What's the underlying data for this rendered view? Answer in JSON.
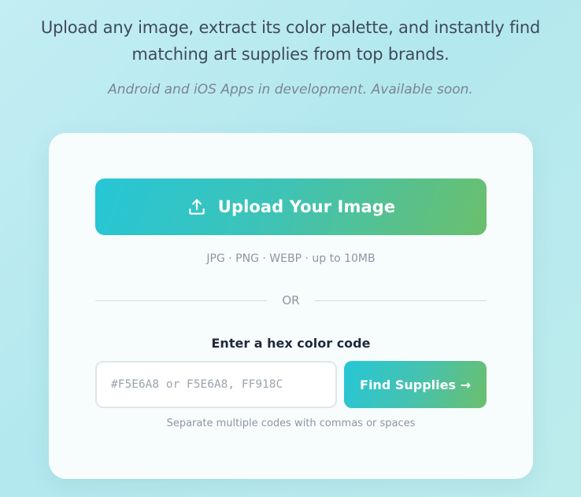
{
  "intro": {
    "line1": "Upload any image, extract its color palette, and instantly find",
    "line2": "matching art supplies from top brands."
  },
  "availability_note": "Android and iOS Apps in development. Available soon.",
  "upload": {
    "icon": "upload-icon",
    "label": "Upload Your Image",
    "formats": "JPG · PNG · WEBP · up to 10MB"
  },
  "divider_text": "OR",
  "hex": {
    "label": "Enter a hex color code",
    "placeholder": "#F5E6A8 or F5E6A8, FF918C",
    "value": "",
    "button_label": "Find Supplies →",
    "hint": "Separate multiple codes with commas or spaces"
  },
  "colors": {
    "gradient_start": "#26c6d6",
    "gradient_end": "#6bbf6c",
    "text_primary": "#1f2a3b",
    "text_muted": "#8e96a3"
  }
}
